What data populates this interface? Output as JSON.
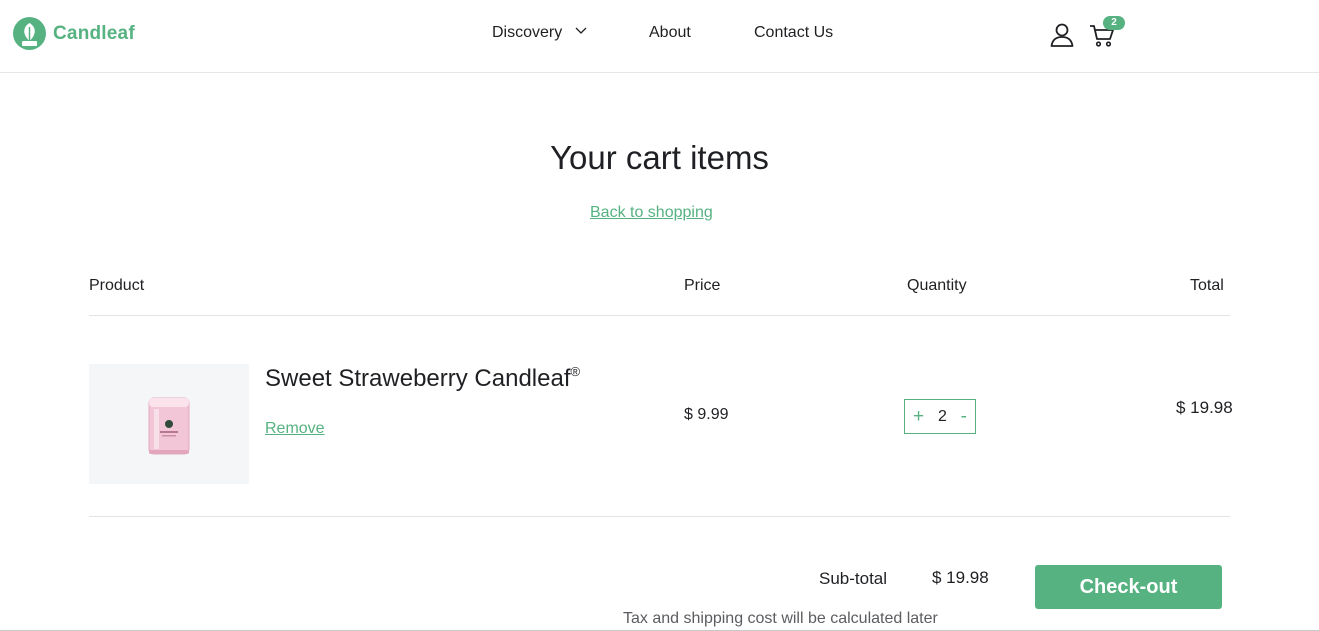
{
  "brand": {
    "name": "Candleaf",
    "accent_color": "#56b280"
  },
  "nav": {
    "items": [
      {
        "label": "Discovery",
        "has_dropdown": true
      },
      {
        "label": "About"
      },
      {
        "label": "Contact Us"
      }
    ],
    "user_icon": "user-icon",
    "cart_icon": "cart-icon",
    "cart_count": "2"
  },
  "cart": {
    "title": "Your cart items",
    "back_link": "Back to shopping",
    "columns": {
      "product": "Product",
      "price": "Price",
      "quantity": "Quantity",
      "total": "Total"
    },
    "items": [
      {
        "name": "Sweet Straweberry Candleaf",
        "trademark": "®",
        "remove_label": "Remove",
        "price": "$ 9.99",
        "quantity": "2",
        "increment_label": "+",
        "decrement_label": "-",
        "total": "$ 19.98"
      }
    ],
    "subtotal_label": "Sub-total",
    "subtotal_value": "$ 19.98",
    "tax_note": "Tax and shipping cost will be calculated later",
    "checkout_label": "Check-out"
  }
}
